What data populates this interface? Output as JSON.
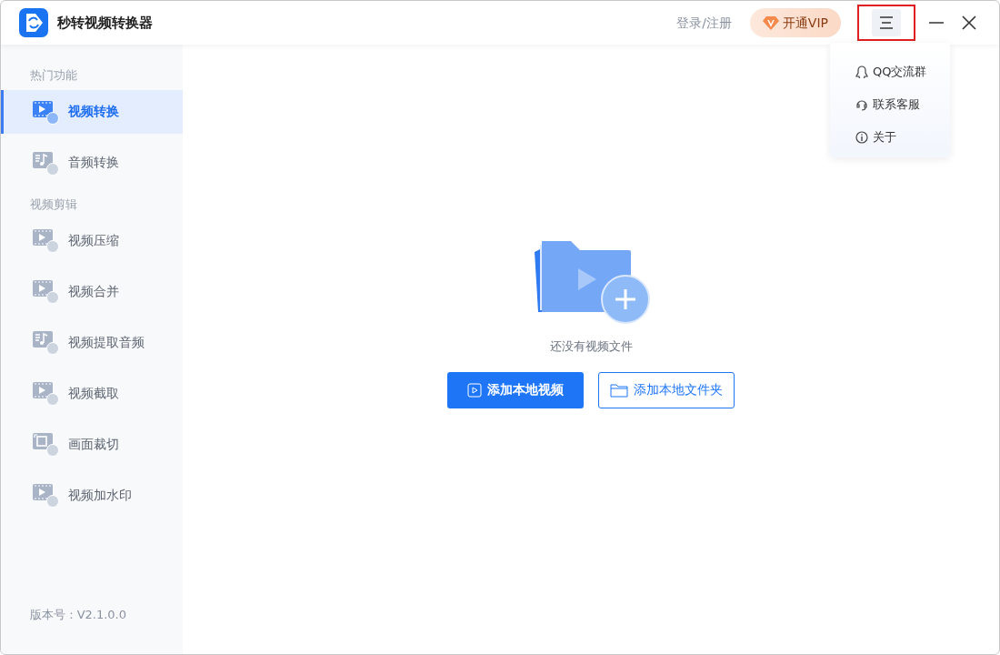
{
  "app": {
    "title": "秒转视频转换器"
  },
  "header": {
    "login": "登录/注册",
    "vip": "开通VIP",
    "menu_highlighted": true
  },
  "menu": [
    {
      "kind": "qq",
      "label": "QQ交流群"
    },
    {
      "kind": "service",
      "label": "联系客服"
    },
    {
      "kind": "info",
      "label": "关于"
    }
  ],
  "sidebar": {
    "sections": [
      {
        "title": "热门功能",
        "items": [
          {
            "kind": "film",
            "label": "视频转换",
            "selected": true
          },
          {
            "kind": "music",
            "label": "音频转换",
            "selected": false
          }
        ]
      },
      {
        "title": "视频剪辑",
        "items": [
          {
            "kind": "film",
            "label": "视频压缩",
            "selected": false
          },
          {
            "kind": "film",
            "label": "视频合并",
            "selected": false
          },
          {
            "kind": "music",
            "label": "视频提取音频",
            "selected": false
          },
          {
            "kind": "film",
            "label": "视频截取",
            "selected": false
          },
          {
            "kind": "frame",
            "label": "画面裁切",
            "selected": false
          },
          {
            "kind": "film",
            "label": "视频加水印",
            "selected": false
          }
        ]
      }
    ],
    "version": "版本号 : V2.1.0.0"
  },
  "main": {
    "empty_text": "还没有视频文件",
    "primary_button": "添加本地视频",
    "secondary_button": "添加本地文件夹"
  }
}
